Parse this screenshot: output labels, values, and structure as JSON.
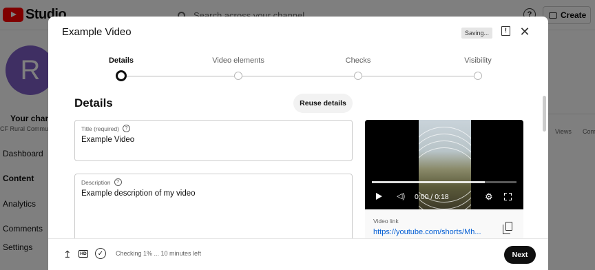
{
  "background": {
    "logo_text": "Studio",
    "search_placeholder": "Search across your channel",
    "help_label": "?",
    "create_label": "Create",
    "avatar_letter": "R",
    "channel_title": "Your chann",
    "channel_subtitle": "CF Rural Commu",
    "nav": [
      "Dashboard",
      "Content",
      "Analytics",
      "Comments",
      "Settings"
    ],
    "table_headers": [
      "Views",
      "Com"
    ]
  },
  "modal": {
    "title": "Example Video",
    "saving_chip": "Saving...",
    "feedback_glyph": "!",
    "close_glyph": "✕",
    "steps": [
      {
        "label": "Details",
        "active": true
      },
      {
        "label": "Video elements",
        "active": false
      },
      {
        "label": "Checks",
        "active": false
      },
      {
        "label": "Visibility",
        "active": false
      }
    ],
    "section_title": "Details",
    "reuse_button": "Reuse details",
    "help_glyph": "?",
    "title_field": {
      "label": "Title (required)",
      "value": "Example Video"
    },
    "description_field": {
      "label": "Description",
      "value": "Example description of my video"
    },
    "preview": {
      "progress_fraction": 0.78,
      "time": "0:00 / 0:18",
      "volume_glyph": "◁)",
      "gear_glyph": "⚙",
      "link_label": "Video link",
      "link_value": "https://youtube.com/shorts/Mh..."
    },
    "footer": {
      "upload_glyph": "↥",
      "hd_badge": "HD",
      "check_glyph": "✓",
      "status": "Checking 1% ... 10 minutes left",
      "next_button": "Next"
    }
  },
  "colors": {
    "accent_link": "#065fd4",
    "brand_red": "#ff0000",
    "primary_button": "#0f0f0f",
    "avatar": "#7e5fc7"
  }
}
